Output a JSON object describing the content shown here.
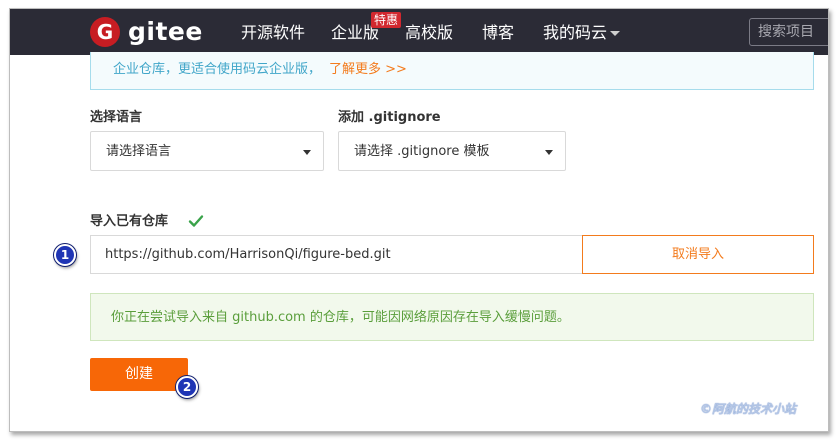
{
  "navbar": {
    "logo_letter": "G",
    "logo_text": "gitee",
    "items": [
      {
        "label": "开源软件"
      },
      {
        "label": "企业版"
      },
      {
        "label": "高校版"
      },
      {
        "label": "博客"
      },
      {
        "label": "我的码云"
      }
    ],
    "badge": "特惠",
    "search_placeholder": "搜索项目"
  },
  "notice": {
    "text": "企业仓库，更适合使用码云企业版，",
    "link": "了解更多 >>"
  },
  "language": {
    "label": "选择语言",
    "placeholder": "请选择语言"
  },
  "gitignore": {
    "label": "添加 .gitignore",
    "placeholder": "请选择 .gitignore 模板"
  },
  "import": {
    "label": "导入已有仓库",
    "url": "https://github.com/HarrisonQi/figure-bed.git",
    "cancel_label": "取消导入",
    "message": "你正在尝试导入来自 github.com 的仓库，可能因网络原因存在导入缓慢问题。"
  },
  "create_label": "创建",
  "callouts": [
    "1",
    "2"
  ],
  "watermark": "©阿航的技术小站",
  "colors": {
    "navbar_bg": "#2b2b36",
    "brand_red": "#c71d23",
    "accent_orange": "#f76707",
    "info_blue": "#41a6c9",
    "success_green": "#5a9e3b"
  }
}
